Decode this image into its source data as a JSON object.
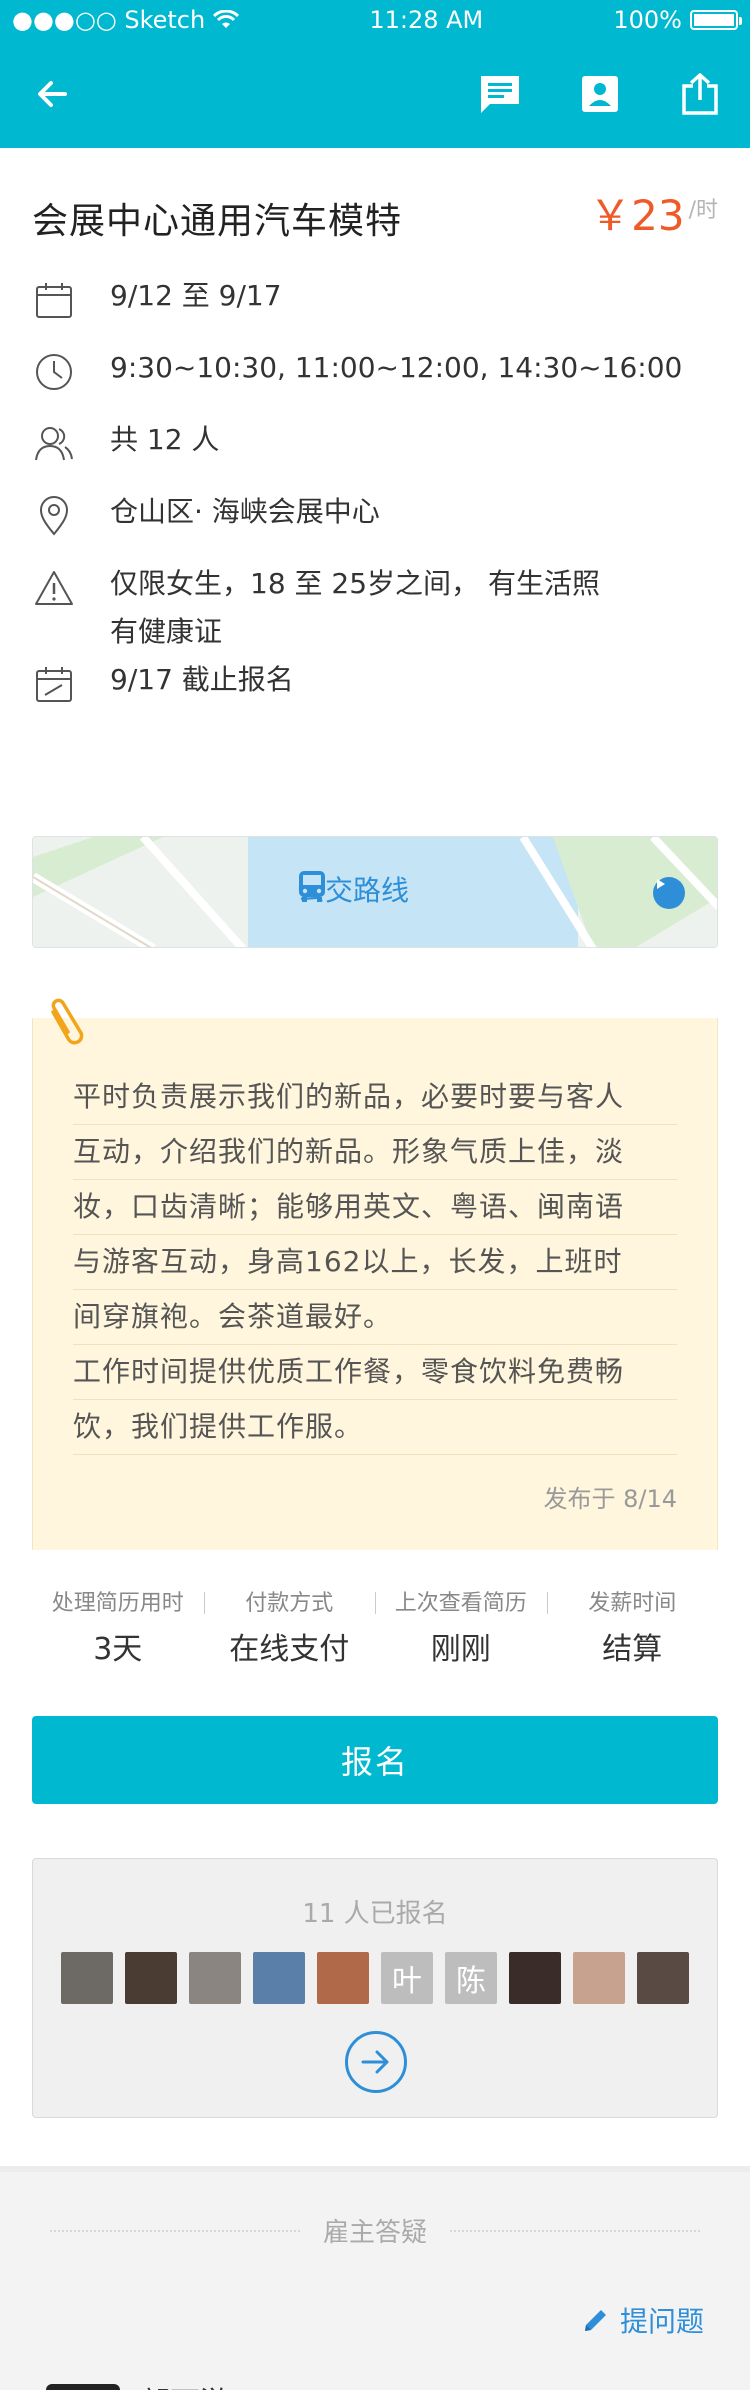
{
  "status_bar": {
    "carrier": "●●●○○ Sketch",
    "time": "11:28 AM",
    "battery": "100%",
    "battery_level": 1.0
  },
  "nav": {
    "back_icon": "arrow-left-icon",
    "actions": [
      "message-icon",
      "contact-card-icon",
      "share-icon"
    ]
  },
  "job": {
    "title": "会展中心通用汽车模特",
    "price": "￥23",
    "price_unit": "/时"
  },
  "info": [
    {
      "icon": "calendar-icon",
      "text": "9/12 至 9/17"
    },
    {
      "icon": "clock-icon",
      "text": "9:30~10:30, 11:00~12:00, 14:30~16:00"
    },
    {
      "icon": "people-icon",
      "text": "共 12 人"
    },
    {
      "icon": "location-pin-icon",
      "text": "仓山区· 海峡会展中心"
    },
    {
      "icon": "warning-icon",
      "text": "仅限女生，18 至 25岁之间， 有生活照",
      "text2": "有健康证"
    },
    {
      "icon": "deadline-calendar-icon",
      "text": "9/17 截止报名"
    }
  ],
  "map": {
    "label": "公交路线",
    "icon": "bus-icon"
  },
  "description": {
    "lines": [
      "平时负责展示我们的新品，必要时要与客人",
      "互动，介绍我们的新品。形象气质上佳，淡",
      "妆，口齿清晰；能够用英文、粤语、闽南语",
      "与游客互动，身高162以上，长发，上班时",
      "间穿旗袍。会茶道最好。",
      "工作时间提供优质工作餐，零食饮料免费畅",
      "饮，我们提供工作服。"
    ],
    "published": "发布于 8/14"
  },
  "stats": [
    {
      "label": "处理简历用时",
      "value": "3天"
    },
    {
      "label": "付款方式",
      "value": "在线支付"
    },
    {
      "label": "上次查看简历",
      "value": "刚刚"
    },
    {
      "label": "发薪时间",
      "value": "结算"
    }
  ],
  "signup_label": "报名",
  "applicants": {
    "count_text": "11 人已报名",
    "text_avatars": [
      "叶",
      "陈"
    ],
    "colors": [
      "#6d6a66",
      "#4a3b33",
      "#8a8580",
      "#5a7fa8",
      "#b06a4a",
      "#bdbdbd",
      "#bdbdbd",
      "#3a2c28",
      "#c7a38f",
      "#5a4a44"
    ]
  },
  "qa": {
    "heading": "雇主答疑",
    "ask_label": "提问题",
    "first_name": "郭可游"
  },
  "colors": {
    "primary": "#00b8cf",
    "price": "#f05a28",
    "link": "#2e8fd8",
    "note_bg": "#fff6dd"
  }
}
